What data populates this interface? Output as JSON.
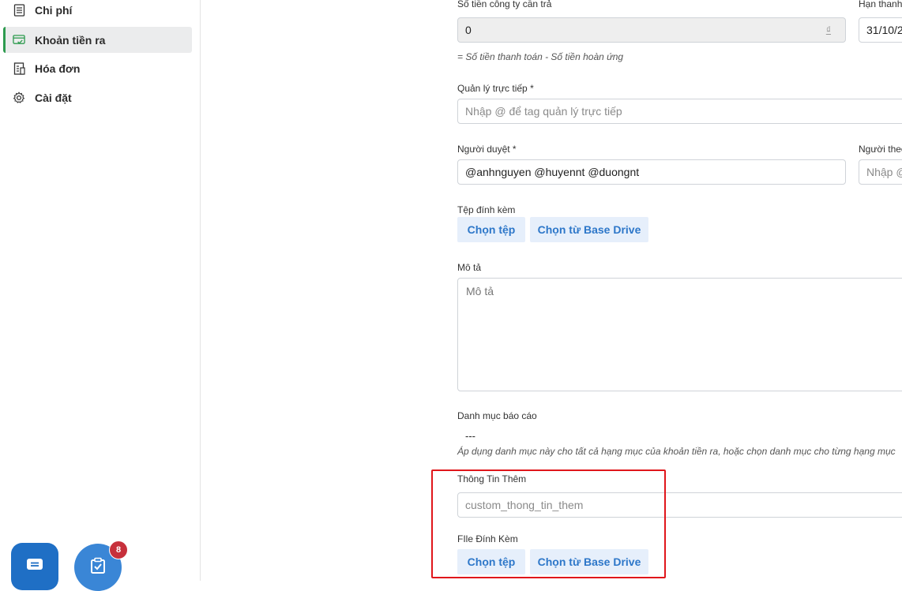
{
  "sidebar": {
    "items": [
      {
        "label": "Chi phí",
        "icon": "document-list-icon"
      },
      {
        "label": "Khoản tiền ra",
        "icon": "payment-card-icon",
        "active": true
      },
      {
        "label": "Hóa đơn",
        "icon": "invoice-icon"
      },
      {
        "label": "Cài đặt",
        "icon": "gear-icon"
      }
    ],
    "task_badge": "8",
    "accent_color": "#2e9b4f"
  },
  "form": {
    "company_pay": {
      "label": "Số tiền công ty cần trả",
      "value": "0",
      "currency": "₫",
      "hint": "= Số tiền thanh toán - Số tiền hoàn ứng"
    },
    "deadline": {
      "label": "Hạn thanh",
      "value": "31/10/2"
    },
    "manager": {
      "label": "Quản lý trực tiếp *",
      "placeholder": "Nhập @ để tag quản lý trực tiếp"
    },
    "approvers": {
      "label": "Người duyệt *",
      "value": "@anhnguyen @huyennt @duongnt"
    },
    "followers": {
      "label": "Người theo",
      "placeholder": "Nhập @"
    },
    "attachments": {
      "label": "Tệp đính kèm",
      "choose_file": "Chọn tệp",
      "choose_drive": "Chọn từ Base Drive"
    },
    "description": {
      "label": "Mô tả",
      "placeholder": "Mô tả"
    },
    "report_category": {
      "label": "Danh mục báo cáo",
      "value": "---",
      "hint": "Áp dụng danh mục này cho tất cả hạng mục của khoản tiền ra, hoặc chọn danh mục cho từng hạng mục"
    },
    "extra_info": {
      "label": "Thông Tin Thêm",
      "placeholder": "custom_thong_tin_them"
    },
    "extra_file": {
      "label": "FIle Đính Kèm",
      "choose_file": "Chọn tệp",
      "choose_drive": "Chọn từ Base Drive"
    }
  },
  "highlight_color": "#e0161b"
}
